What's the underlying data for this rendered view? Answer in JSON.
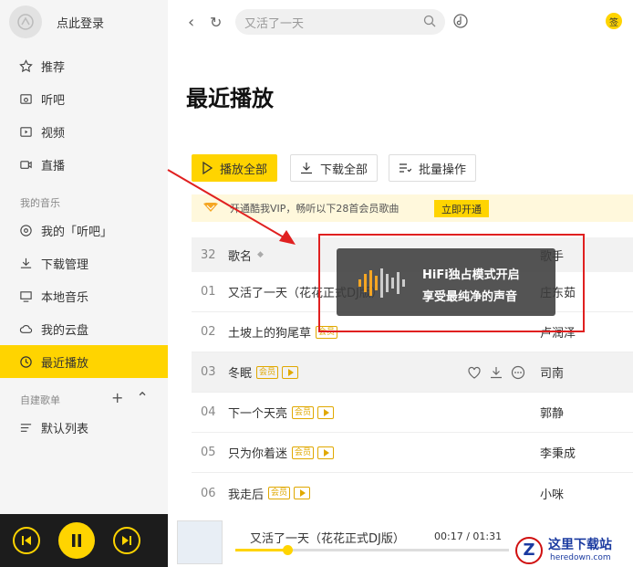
{
  "sidebar": {
    "login_label": "点此登录",
    "items": [
      {
        "label": "推荐",
        "icon": "star-icon"
      },
      {
        "label": "听吧",
        "icon": "radio-icon"
      },
      {
        "label": "视频",
        "icon": "video-icon"
      },
      {
        "label": "直播",
        "icon": "live-icon"
      }
    ],
    "my_music_label": "我的音乐",
    "my_items": [
      {
        "label": "我的「听吧」",
        "icon": "headphone-icon"
      },
      {
        "label": "下载管理",
        "icon": "download-icon"
      },
      {
        "label": "本地音乐",
        "icon": "monitor-icon"
      },
      {
        "label": "我的云盘",
        "icon": "cloud-icon"
      },
      {
        "label": "最近播放",
        "icon": "clock-icon"
      }
    ],
    "playlist_label": "自建歌单",
    "playlists": [
      {
        "label": "默认列表"
      }
    ]
  },
  "topbar": {
    "search_value": "又活了一天"
  },
  "sign_badge": "签",
  "main": {
    "title": "最近播放",
    "buttons": {
      "play_all": "播放全部",
      "download_all": "下载全部",
      "batch": "批量操作"
    },
    "vip": {
      "text": "开通酷我VIP，畅听以下28首会员歌曲",
      "open": "立即开通"
    },
    "table": {
      "count": "32",
      "col_song": "歌名",
      "col_artist": "歌手",
      "rows": [
        {
          "num": "01",
          "song": "又活了一天（花花正式DJ版）",
          "artist": "庄东茹",
          "tags": []
        },
        {
          "num": "02",
          "song": "土坡上的狗尾草",
          "artist": "卢润泽",
          "tags": [
            "会员"
          ]
        },
        {
          "num": "03",
          "song": "冬眠",
          "artist": "司南",
          "tags": [
            "会员",
            "mv"
          ]
        },
        {
          "num": "04",
          "song": "下一个天亮",
          "artist": "郭静",
          "tags": [
            "会员",
            "mv"
          ]
        },
        {
          "num": "05",
          "song": "只为你着迷",
          "artist": "李秉成",
          "tags": [
            "会员",
            "mv"
          ]
        },
        {
          "num": "06",
          "song": "我走后",
          "artist": "小咪",
          "tags": [
            "会员",
            "mv"
          ]
        }
      ]
    }
  },
  "toast": {
    "line1": "HiFi独占模式开启",
    "line2": "享受最纯净的声音"
  },
  "player": {
    "title": "又活了一天（花花正式DJ版）",
    "elapsed": "00:17",
    "total": "01:31",
    "progress": 0.19
  },
  "watermark": {
    "title": "这里下载站",
    "url": "heredown.com"
  },
  "colors": {
    "accent": "#ffd400",
    "annotation": "#e02020"
  }
}
